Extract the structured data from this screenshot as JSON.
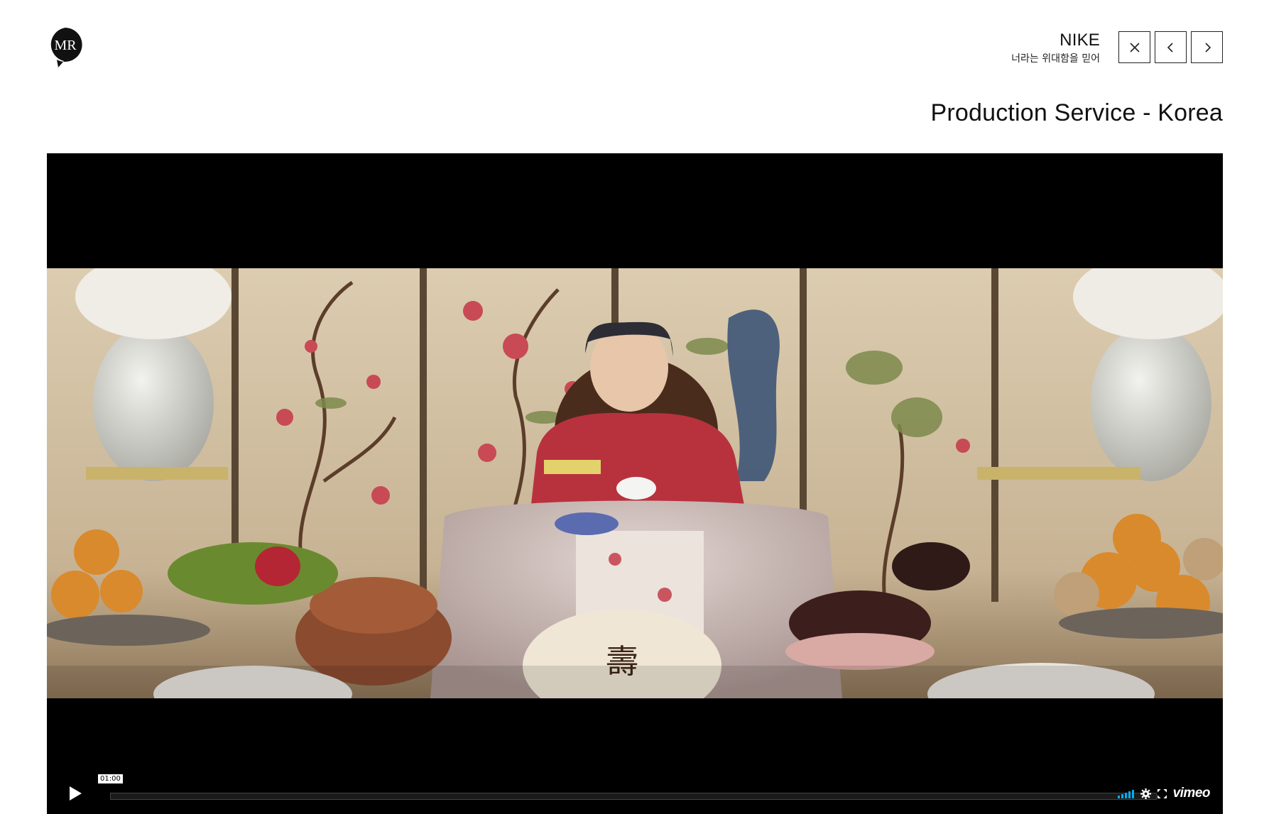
{
  "brand": {
    "logo_text": "MR"
  },
  "project": {
    "title": "NIKE",
    "subtitle": "너라는 위대함을 믿어"
  },
  "nav": {
    "close_icon": "close-icon",
    "prev_icon": "chevron-left-icon",
    "next_icon": "chevron-right-icon"
  },
  "page": {
    "title": "Production Service - Korea"
  },
  "player": {
    "timecode": "01:00",
    "progress": 0,
    "provider_logo": "vimeo",
    "accent_color": "#00adef",
    "icons": [
      "play-icon",
      "volume-icon",
      "settings-icon",
      "fullscreen-icon"
    ]
  }
}
